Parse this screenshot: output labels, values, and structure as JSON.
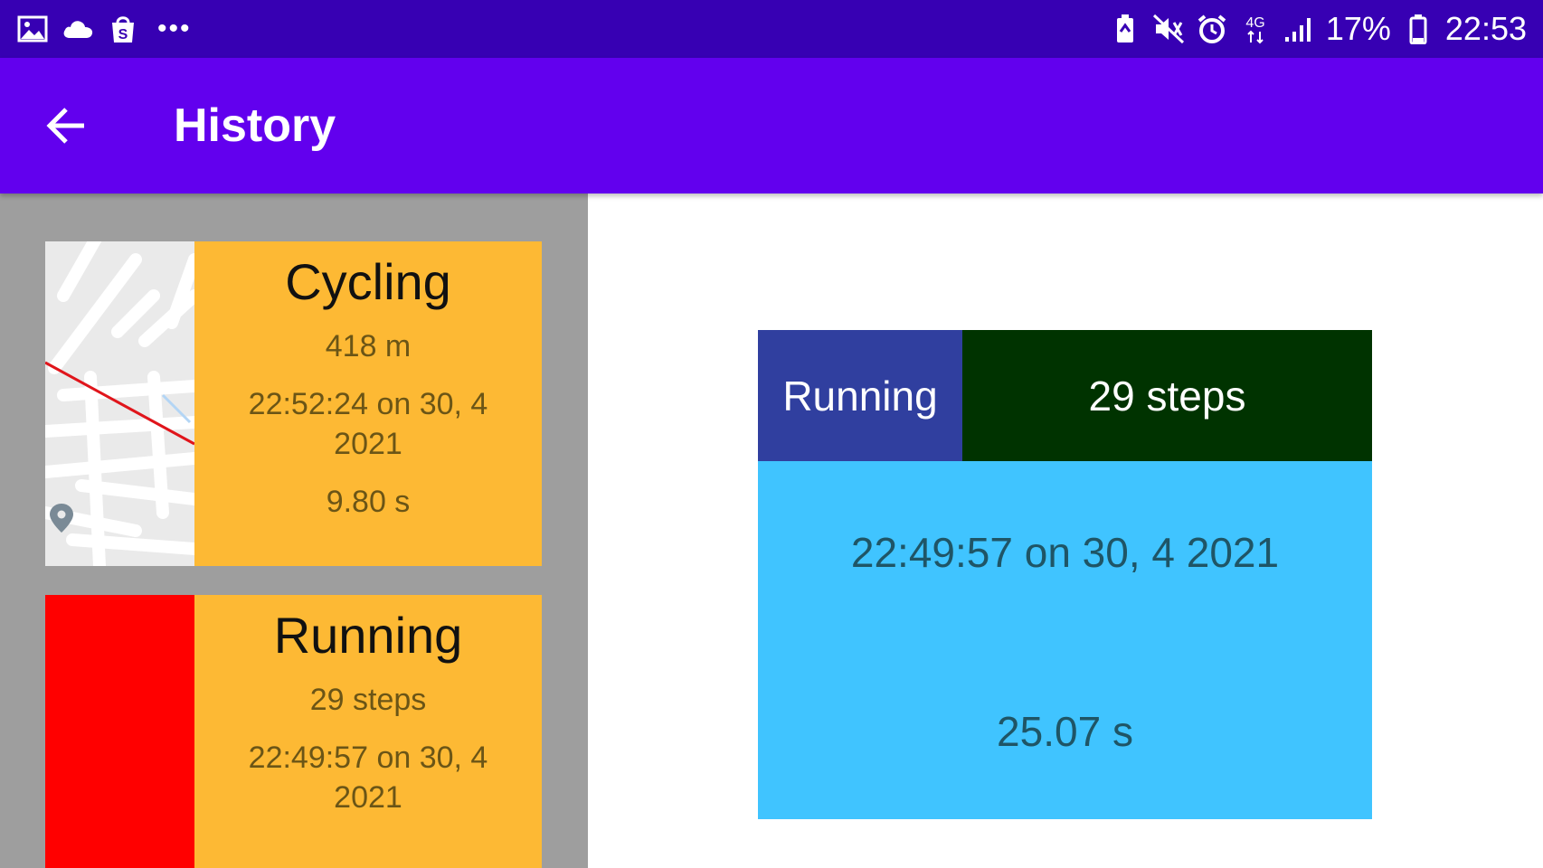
{
  "status_bar": {
    "battery_percent": "17%",
    "time": "22:53",
    "left_icons": [
      "gallery-icon",
      "cloud-icon",
      "shopping-bag-icon",
      "more-dots-icon"
    ],
    "right_icons": [
      "battery-saver-icon",
      "vibrate-mute-icon",
      "alarm-clock-icon",
      "network-4g-icon",
      "signal-icon",
      "battery-icon"
    ],
    "network_label": "4G"
  },
  "app_bar": {
    "title": "History",
    "back_icon": "arrow-back-icon",
    "color": "#6200ee"
  },
  "history": {
    "items": [
      {
        "type": "Cycling",
        "value": "418 m",
        "datetime": "22:52:24 on 30, 4 2021",
        "duration": "9.80 s",
        "thumbnail": "map-route"
      },
      {
        "type": "Running",
        "value": "29 steps",
        "datetime": "22:49:57 on 30, 4 2021",
        "thumbnail": "red-square"
      }
    ]
  },
  "detail": {
    "type": "Running",
    "value": "29 steps",
    "datetime": "22:49:57 on 30, 4 2021",
    "duration": "25.07 s"
  },
  "colors": {
    "status_bar": "#3700b3",
    "app_bar": "#6200ee",
    "list_background": "#9e9e9e",
    "card": "#fdb934",
    "running_thumbnail": "#ff0000",
    "detail_type_box": "#303f9f",
    "detail_value_box": "#003300",
    "detail_body": "#40c4ff"
  }
}
